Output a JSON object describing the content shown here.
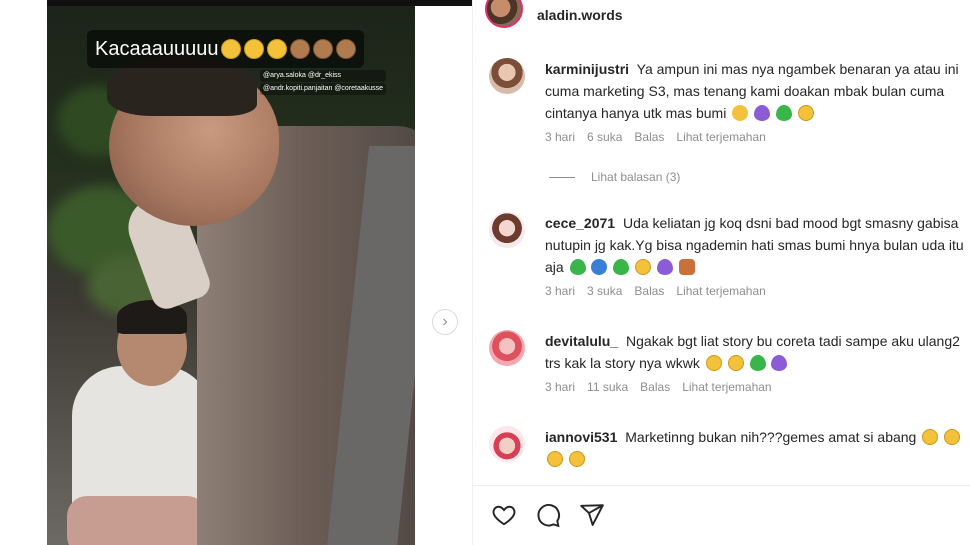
{
  "story": {
    "caption": "Kacaaauuuuu",
    "tags": [
      "@arya.saloka @dr_ekiss",
      "@andr.kopiti.panjaitan @coretaakusse"
    ]
  },
  "header": {
    "username": "aladin.words"
  },
  "comments": [
    {
      "username": "karminijustri",
      "text": "Ya ampun ini mas nya ngambek benaran ya atau ini cuma marketing S3, mas tenang kami doakan mbak bulan cuma cintanya hanya utk mas bumi",
      "time": "3 hari",
      "likes": "6 suka",
      "reply": "Balas",
      "translate": "Lihat terjemahan"
    },
    {
      "username": "cece_2071",
      "text": "Uda keliatan jg koq dsni bad mood bgt smasny gabisa nutupin jg kak.Yg bisa ngademin hati smas bumi hnya bulan uda itu aja",
      "time": "3 hari",
      "likes": "3 suka",
      "reply": "Balas",
      "translate": "Lihat terjemahan"
    },
    {
      "username": "devitalulu_",
      "text": "Ngakak bgt liat story bu coreta tadi sampe aku ulang2 trs kak la story nya wkwk",
      "time": "3 hari",
      "likes": "11 suka",
      "reply": "Balas",
      "translate": "Lihat terjemahan"
    },
    {
      "username": "iannovi531",
      "text": "Marketinng bukan nih???gemes amat si abang"
    }
  ],
  "view_replies": "Lihat balasan (3)",
  "icons": [
    "heart-icon",
    "comment-icon",
    "share-icon",
    "chevron-right-icon"
  ],
  "colors": {
    "accent_ring": "#e1306c",
    "meta_text": "#8e8e8e",
    "text": "#262626"
  }
}
